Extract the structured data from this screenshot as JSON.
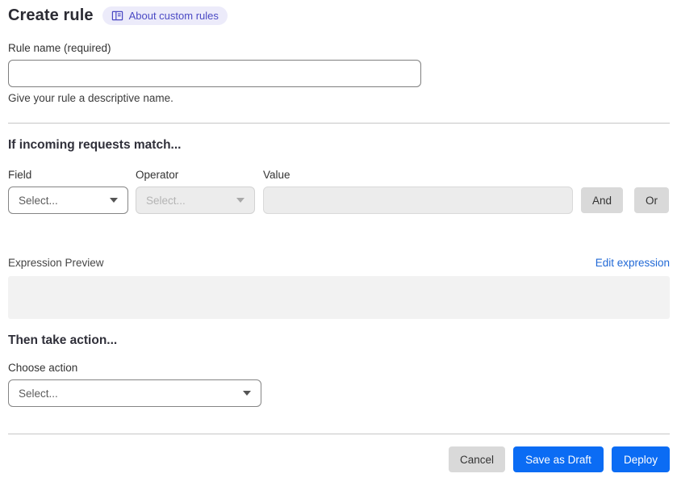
{
  "page": {
    "title": "Create rule",
    "about_link_label": "About custom rules"
  },
  "rule_name": {
    "label": "Rule name (required)",
    "value": "",
    "placeholder": "",
    "help": "Give your rule a descriptive name."
  },
  "match_section": {
    "heading": "If incoming requests match...",
    "field_label": "Field",
    "operator_label": "Operator",
    "value_label": "Value",
    "field_value": "Select...",
    "operator_value": "Select...",
    "value_value": "",
    "and_label": "And",
    "or_label": "Or",
    "expression_preview_label": "Expression Preview",
    "edit_expression_label": "Edit expression",
    "expression_value": ""
  },
  "action_section": {
    "heading": "Then take action...",
    "choose_label": "Choose action",
    "action_value": "Select..."
  },
  "footer": {
    "cancel_label": "Cancel",
    "save_draft_label": "Save as Draft",
    "deploy_label": "Deploy"
  },
  "icons": {
    "about_badge": "book-icon",
    "dropdowns": "caret-down-icon"
  },
  "colors": {
    "primary_blue": "#0b6cf4",
    "link_blue": "#2169d6",
    "badge_bg": "#ecebfa",
    "badge_text": "#4a49c4",
    "gray_button": "#d9d9d9",
    "disabled_bg": "#ececec",
    "preview_bg": "#f2f2f2",
    "divider": "#c6c6c6",
    "heading_text": "#30303a"
  }
}
